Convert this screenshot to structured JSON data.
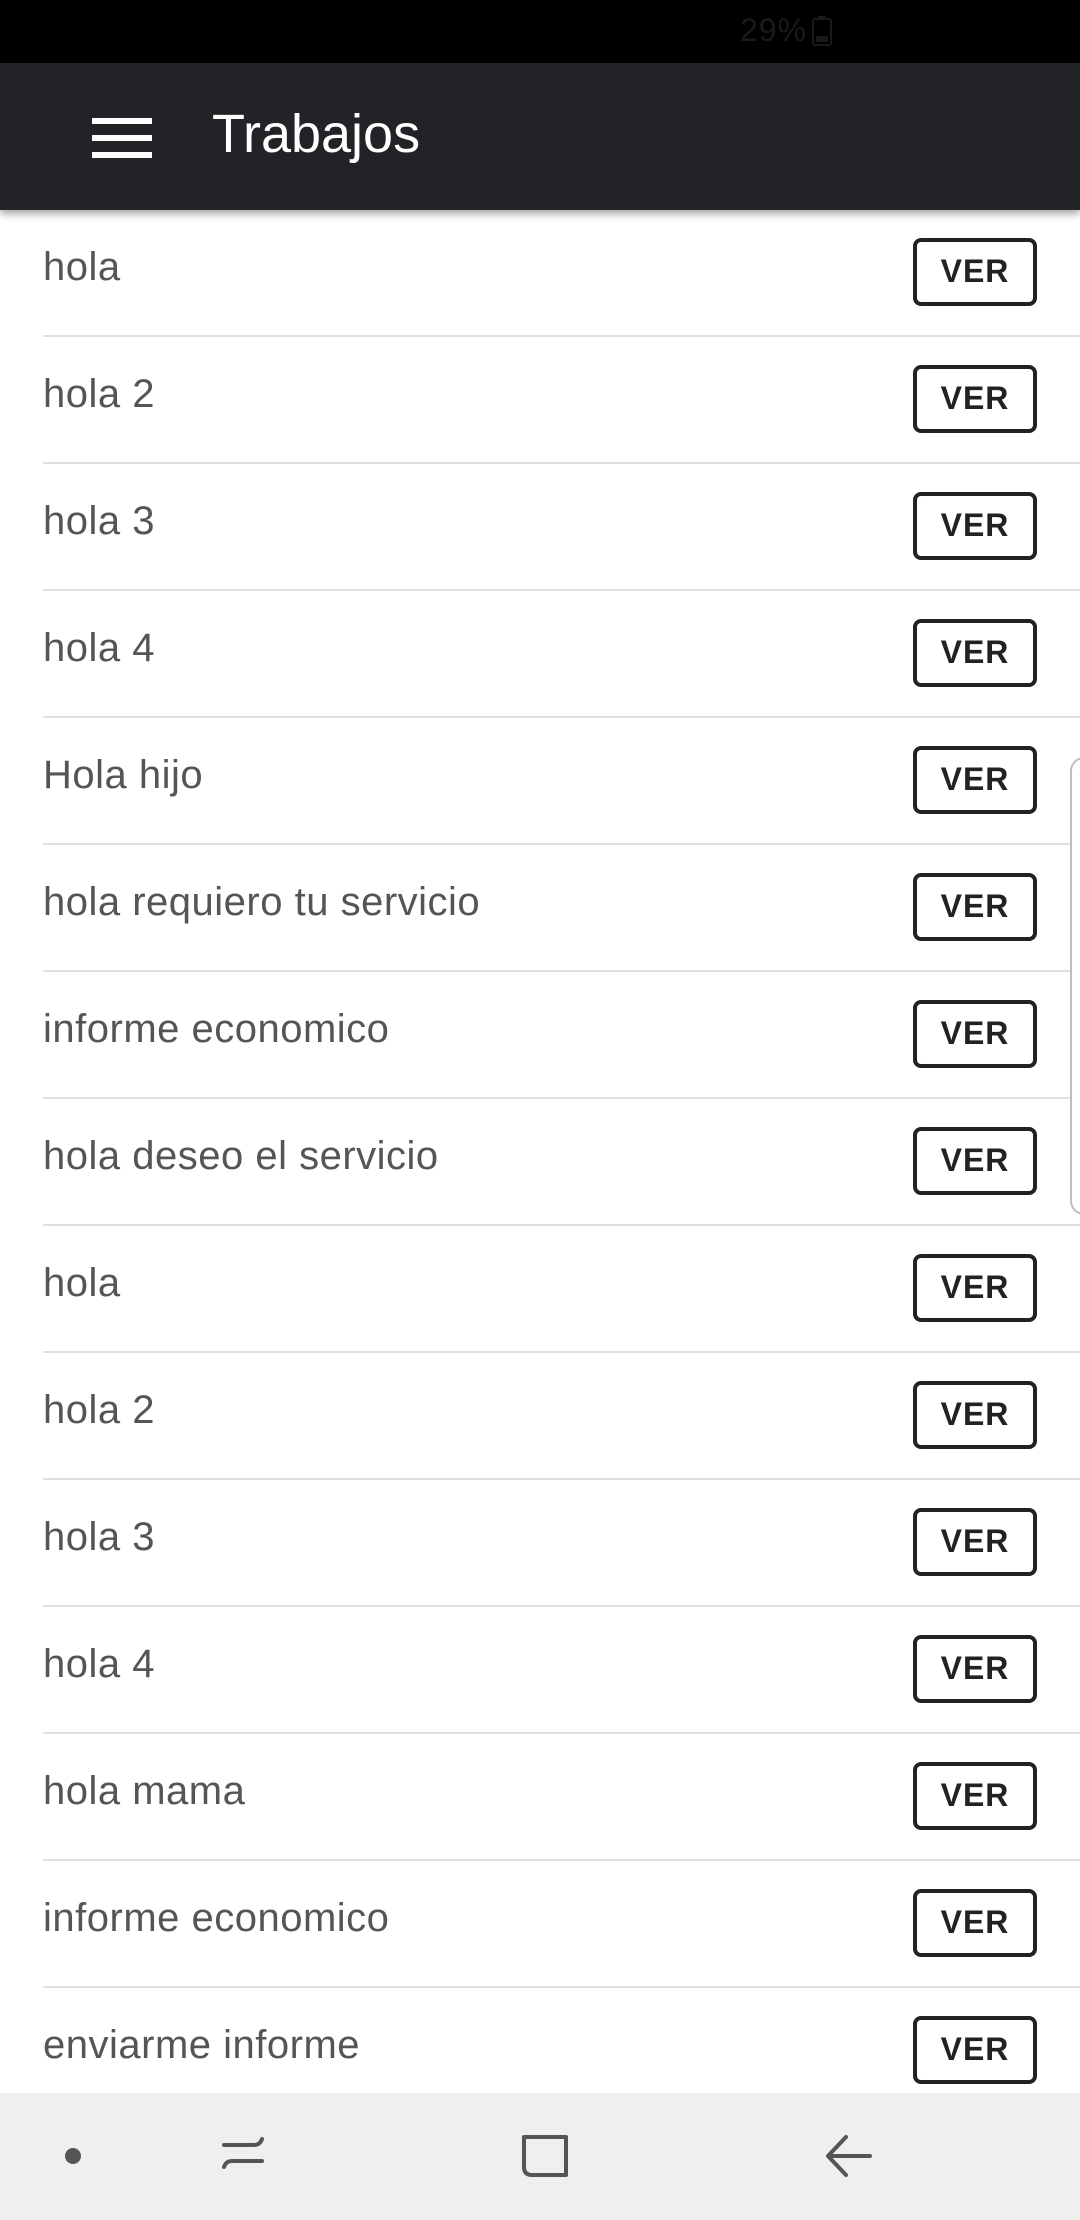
{
  "status_bar": {
    "battery_text": "29%",
    "battery_icon": "battery-icon"
  },
  "app_bar": {
    "title": "Trabajos",
    "menu_icon": "hamburger-menu-icon"
  },
  "jobs": [
    {
      "title": "hola",
      "action": "VER"
    },
    {
      "title": "hola 2",
      "action": "VER"
    },
    {
      "title": "hola 3",
      "action": "VER"
    },
    {
      "title": "hola 4",
      "action": "VER"
    },
    {
      "title": "Hola hijo",
      "action": "VER"
    },
    {
      "title": "hola requiero tu servicio",
      "action": "VER"
    },
    {
      "title": "informe economico",
      "action": "VER"
    },
    {
      "title": "hola deseo el servicio",
      "action": "VER"
    },
    {
      "title": "hola",
      "action": "VER"
    },
    {
      "title": "hola 2",
      "action": "VER"
    },
    {
      "title": "hola 3",
      "action": "VER"
    },
    {
      "title": "hola 4",
      "action": "VER"
    },
    {
      "title": "hola mama",
      "action": "VER"
    },
    {
      "title": "informe economico",
      "action": "VER"
    },
    {
      "title": "enviarme informe",
      "action": "VER"
    }
  ],
  "nav_bar": {
    "items": [
      "dot-icon",
      "recent-apps-icon",
      "home-icon",
      "back-icon"
    ]
  },
  "colors": {
    "app_bar": "#222326",
    "status_bar": "#000000",
    "nav_bar": "#efefef",
    "text": "#555555",
    "button_border": "#222222"
  }
}
